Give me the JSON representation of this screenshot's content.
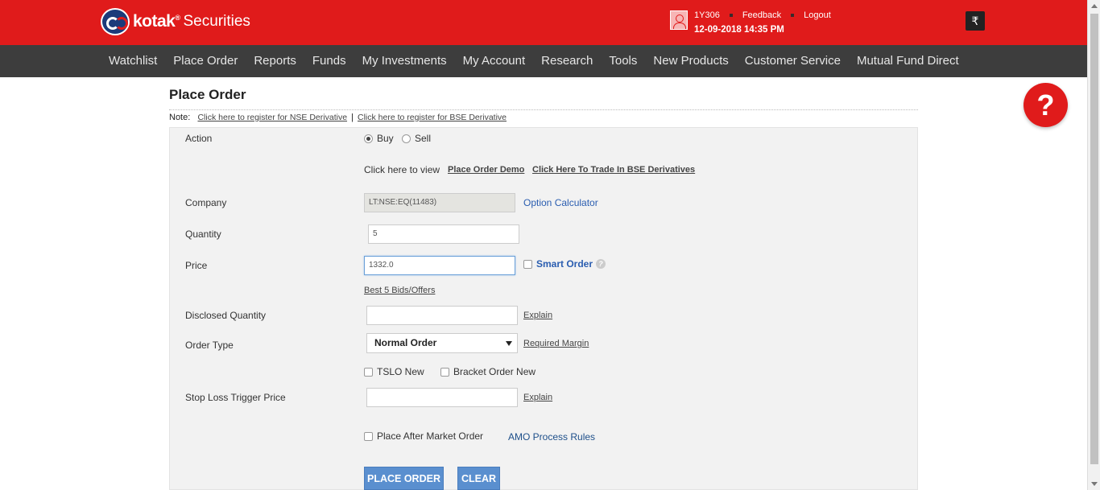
{
  "header": {
    "logo_text": "kotak",
    "logo_reg": "®",
    "logo_sub": "Securities",
    "user_id": "1Y306",
    "feedback": "Feedback",
    "logout": "Logout",
    "datetime": "12-09-2018 14:35 PM",
    "rupee_icon": "₹"
  },
  "nav": {
    "items": [
      "Watchlist",
      "Place Order",
      "Reports",
      "Funds",
      "My Investments",
      "My Account",
      "Research",
      "Tools",
      "New Products",
      "Customer Service",
      "Mutual Fund Direct"
    ]
  },
  "help": {
    "symbol": "?"
  },
  "page": {
    "title": "Place Order",
    "note_label": "Note:",
    "nse_link": "Click here to register for NSE Derivative",
    "pipe": "|",
    "bse_link": "Click here to register for BSE Derivative"
  },
  "form": {
    "action_label": "Action",
    "buy": "Buy",
    "sell": "Sell",
    "selected_action": "Buy",
    "view_text": "Click here to view",
    "demo_link": "Place Order Demo",
    "bse_trade_link": "Click Here To Trade In BSE Derivatives",
    "company_label": "Company",
    "company_value": "LT:NSE:EQ(11483)",
    "option_calc": "Option Calculator",
    "quantity_label": "Quantity",
    "quantity_value": "5",
    "price_label": "Price",
    "price_value": "1332.0",
    "smart_order": "Smart Order",
    "q_mark": "?",
    "best_bids": "Best 5 Bids/Offers",
    "disclosed_label": "Disclosed Quantity",
    "disclosed_value": "",
    "explain": "Explain",
    "order_type_label": "Order Type",
    "order_type_value": "Normal Order",
    "required_margin": "Required Margin",
    "tslo": "TSLO New",
    "bracket": "Bracket Order New",
    "stoploss_label": "Stop Loss Trigger Price",
    "stoploss_value": "",
    "amo_label": "Place After Market Order",
    "amo_rules": "AMO Process Rules",
    "place_btn": "PLACE ORDER",
    "clear_btn": "CLEAR"
  }
}
